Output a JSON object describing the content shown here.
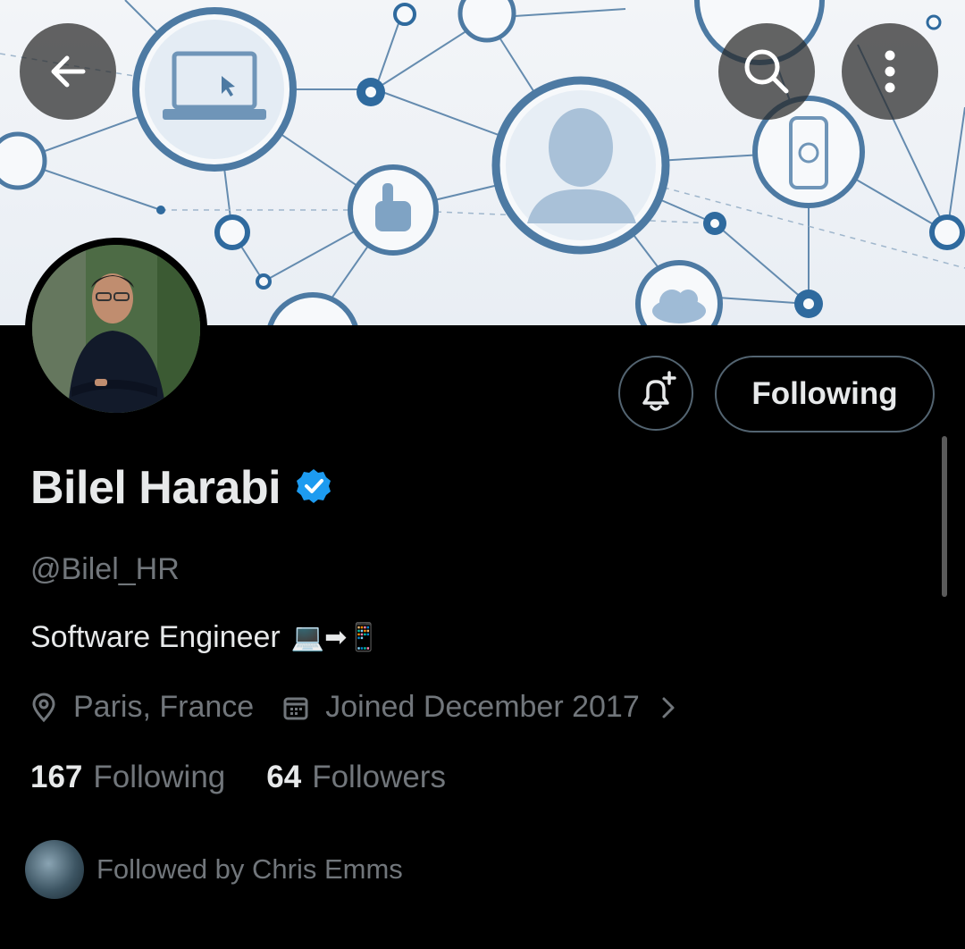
{
  "header": {
    "back_icon": "arrow-left-icon",
    "search_icon": "search-icon",
    "more_icon": "more-vertical-icon"
  },
  "profile": {
    "name": "Bilel Harabi",
    "verified": true,
    "handle": "@Bilel_HR",
    "bio": "Software Engineer",
    "bio_emoji": "💻➡📱",
    "location": "Paris, France",
    "joined": "Joined December 2017"
  },
  "actions": {
    "notify_icon": "bell-plus-icon",
    "follow_label": "Following"
  },
  "stats": {
    "following_count": "167",
    "following_label": "Following",
    "followers_count": "64",
    "followers_label": "Followers"
  },
  "followed_by": {
    "text": "Followed by Chris Emms"
  },
  "colors": {
    "accent": "#1d9bf0",
    "muted": "#71767b",
    "border": "#536471",
    "banner_line": "#3f6e98"
  }
}
